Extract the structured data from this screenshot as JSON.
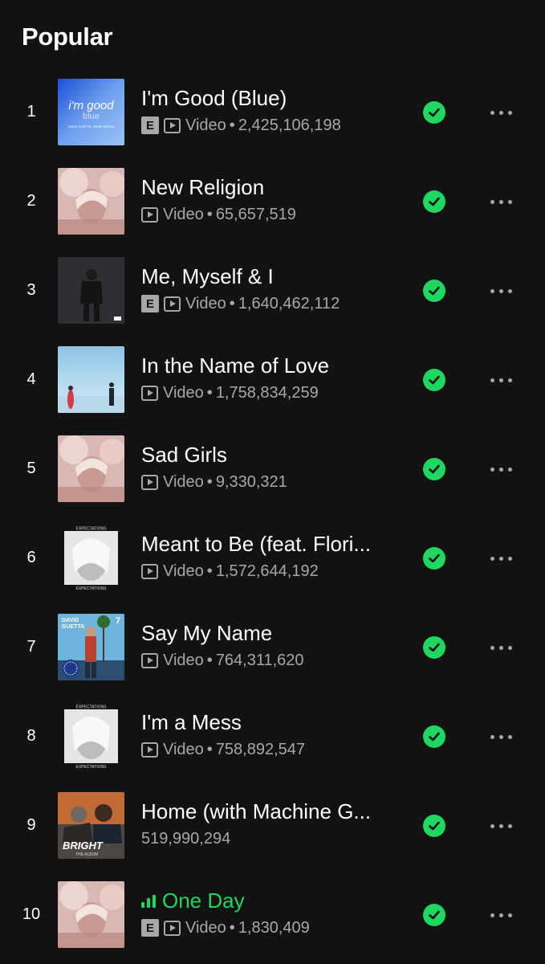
{
  "section": {
    "title": "Popular"
  },
  "colors": {
    "background": "#121212",
    "accent": "#1ed760",
    "secondary_text": "#a7a7a7"
  },
  "tracks": [
    {
      "rank": "1",
      "title": "I'm Good (Blue)",
      "explicit": true,
      "video": true,
      "type_label": "Video",
      "separator": "•",
      "plays": "2,425,106,198",
      "playing": false,
      "saved": true,
      "cover": "blue-abstract",
      "cover_text": [
        "i'm good",
        "blue",
        "DAVID GUETTA · BEBE REXHA"
      ]
    },
    {
      "rank": "2",
      "title": "New Religion",
      "explicit": false,
      "video": true,
      "type_label": "Video",
      "separator": "•",
      "plays": "65,657,519",
      "playing": false,
      "saved": true,
      "cover": "pink-portrait",
      "cover_text": []
    },
    {
      "rank": "3",
      "title": "Me, Myself & I",
      "explicit": true,
      "video": true,
      "type_label": "Video",
      "separator": "•",
      "plays": "1,640,462,112",
      "playing": false,
      "saved": true,
      "cover": "dark-figure",
      "cover_text": []
    },
    {
      "rank": "4",
      "title": "In the Name of Love",
      "explicit": false,
      "video": true,
      "type_label": "Video",
      "separator": "•",
      "plays": "1,758,834,259",
      "playing": false,
      "saved": true,
      "cover": "sky-figures",
      "cover_text": []
    },
    {
      "rank": "5",
      "title": "Sad Girls",
      "explicit": false,
      "video": true,
      "type_label": "Video",
      "separator": "•",
      "plays": "9,330,321",
      "playing": false,
      "saved": true,
      "cover": "pink-portrait",
      "cover_text": []
    },
    {
      "rank": "6",
      "title": "Meant to Be (feat. Flori...",
      "explicit": false,
      "video": true,
      "type_label": "Video",
      "separator": "•",
      "plays": "1,572,644,192",
      "playing": false,
      "saved": true,
      "cover": "bw-portrait",
      "cover_text": [
        "EXPECTATIONS"
      ]
    },
    {
      "rank": "7",
      "title": "Say My Name",
      "explicit": false,
      "video": true,
      "type_label": "Video",
      "separator": "•",
      "plays": "764,311,620",
      "playing": false,
      "saved": true,
      "cover": "palm-street",
      "cover_text": [
        "DAVID",
        "GUETTA",
        "7"
      ]
    },
    {
      "rank": "8",
      "title": "I'm a Mess",
      "explicit": false,
      "video": true,
      "type_label": "Video",
      "separator": "•",
      "plays": "758,892,547",
      "playing": false,
      "saved": true,
      "cover": "bw-portrait",
      "cover_text": [
        "EXPECTATIONS"
      ]
    },
    {
      "rank": "9",
      "title": "Home (with Machine G...",
      "explicit": false,
      "video": false,
      "type_label": "",
      "separator": "",
      "plays": "519,990,294",
      "playing": false,
      "saved": true,
      "cover": "bright-album",
      "cover_text": [
        "BRIGHT",
        "THE ALBUM"
      ]
    },
    {
      "rank": "10",
      "title": "One Day",
      "explicit": true,
      "video": true,
      "type_label": "Video",
      "separator": "•",
      "plays": "1,830,409",
      "playing": true,
      "saved": true,
      "cover": "pink-portrait",
      "cover_text": []
    }
  ],
  "icons": {
    "explicit": "E",
    "saved": "check-circle-icon",
    "more": "more-options-icon",
    "video": "video-icon",
    "playing": "equalizer-icon"
  }
}
